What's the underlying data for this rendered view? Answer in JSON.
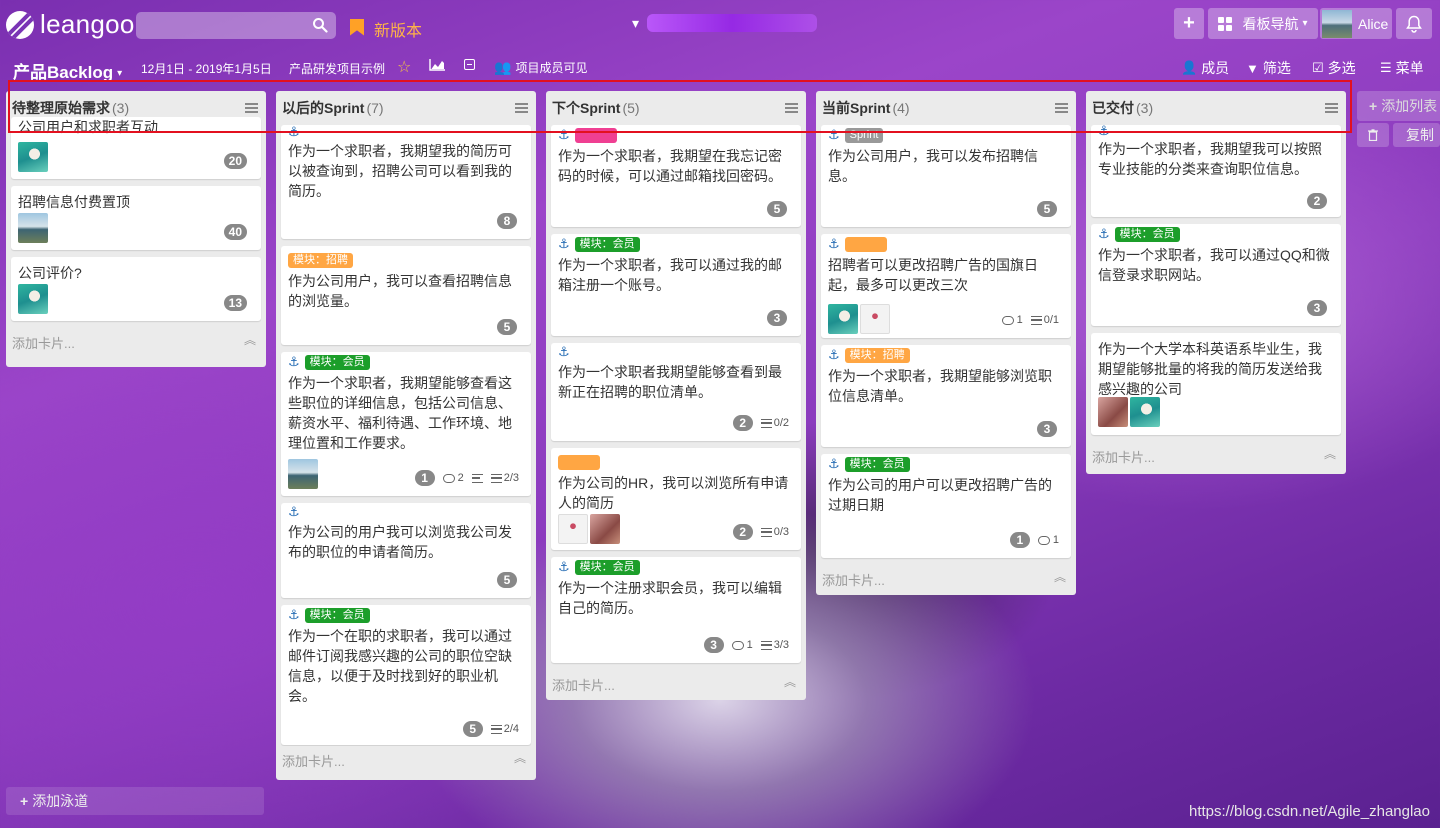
{
  "top": {
    "logo": "leangoo",
    "search_placeholder": "",
    "new_version": "新版本",
    "board_selector_prefix": "▾",
    "add": "+",
    "nav": "看板导航",
    "user": "Alice"
  },
  "board": {
    "name": "产品Backlog",
    "caret": "▾",
    "dates": "12月1日 - 2019年1月5日",
    "project": "产品研发项目示例",
    "visibility": "项目成员可见",
    "members": "成员",
    "filter": "筛选",
    "multi": "多选",
    "menu": "菜单"
  },
  "lists": [
    {
      "title": "待整理原始需求",
      "count": "(3)",
      "add_card": "添加卡片...",
      "cards": [
        {
          "text": "公司用户和求职者互动",
          "badge": "20"
        },
        {
          "text": "招聘信息付费置顶",
          "badge": "40"
        },
        {
          "text": "公司评价?",
          "badge": "13"
        }
      ]
    },
    {
      "title": "以后的Sprint",
      "count": "(7)",
      "add_card": "添加卡片...",
      "cards": [
        {
          "text": "作为一个求职者，我期望我的简历可以被查询到，招聘公司可以看到我的简历。",
          "badge": "8"
        },
        {
          "tag": "模块：招聘",
          "text": "作为公司用户，我可以查看招聘信息的浏览量。",
          "badge": "5"
        },
        {
          "tag": "模块：会员",
          "text": "作为一个求职者，我期望能够查看这些职位的详细信息，包括公司信息、薪资水平、福利待遇、工作环境、地理位置和工作要求。",
          "badge": "1",
          "comments": "2",
          "checklist": "2/3"
        },
        {
          "text": "作为公司的用户我可以浏览我公司发布的职位的申请者简历。",
          "badge": "5"
        },
        {
          "tag": "模块：会员",
          "text": "作为一个在职的求职者，我可以通过邮件订阅我感兴趣的公司的职位空缺信息，以便于及时找到好的职业机会。",
          "badge": "5",
          "checklist": "2/4"
        }
      ]
    },
    {
      "title": "下个Sprint",
      "count": "(5)",
      "add_card": "添加卡片...",
      "cards": [
        {
          "tag": "",
          "text": "作为一个求职者，我期望在我忘记密码的时候，可以通过邮箱找回密码。",
          "badge": "5"
        },
        {
          "tag": "模块：会员",
          "text": "作为一个求职者，我可以通过我的邮箱注册一个账号。",
          "badge": "3"
        },
        {
          "text": "作为一个求职者我期望能够查看到最新正在招聘的职位清单。",
          "badge": "2",
          "checklist": "0/2"
        },
        {
          "tag": "",
          "text": "作为公司的HR，我可以浏览所有申请人的简历",
          "badge": "2",
          "checklist": "0/3"
        },
        {
          "tag": "模块：会员",
          "text": "作为一个注册求职会员，我可以编辑自己的简历。",
          "badge": "3",
          "comments": "1",
          "checklist": "3/3"
        }
      ]
    },
    {
      "title": "当前Sprint",
      "count": "(4)",
      "add_card": "添加卡片...",
      "cards": [
        {
          "tag": "Sprint",
          "text": "作为公司用户，我可以发布招聘信息。",
          "badge": "5"
        },
        {
          "tag": "",
          "text": "招聘者可以更改招聘广告的国旗日起，最多可以更改三次",
          "comments": "1",
          "checklist": "0/1"
        },
        {
          "tag": "模块：招聘",
          "text": "作为一个求职者，我期望能够浏览职位信息清单。",
          "badge": "3"
        },
        {
          "tag": "模块：会员",
          "text": "作为公司的用户可以更改招聘广告的过期日期",
          "badge": "1",
          "comments": "1"
        }
      ]
    },
    {
      "title": "已交付",
      "count": "(3)",
      "add_card": "添加卡片...",
      "cards": [
        {
          "text": "作为一个求职者，我期望我可以按照专业技能的分类来查询职位信息。",
          "badge": "2"
        },
        {
          "tag": "模块：会员",
          "text": "作为一个求职者，我可以通过QQ和微信登录求职网站。",
          "badge": "3"
        },
        {
          "text": "作为一个大学本科英语系毕业生，我期望能够批量的将我的简历发送给我感兴趣的公司"
        }
      ]
    }
  ],
  "side": {
    "add_list": "添加列表",
    "copy": "复制",
    "add_lane": "添加泳道"
  },
  "watermark": "https://blog.csdn.net/Agile_zhanglao",
  "colors": {
    "tag_green": "#1c9e2a",
    "tag_orange": "#ffa643",
    "tag_pink": "#ef3f92",
    "highlight": "#e3101f"
  }
}
